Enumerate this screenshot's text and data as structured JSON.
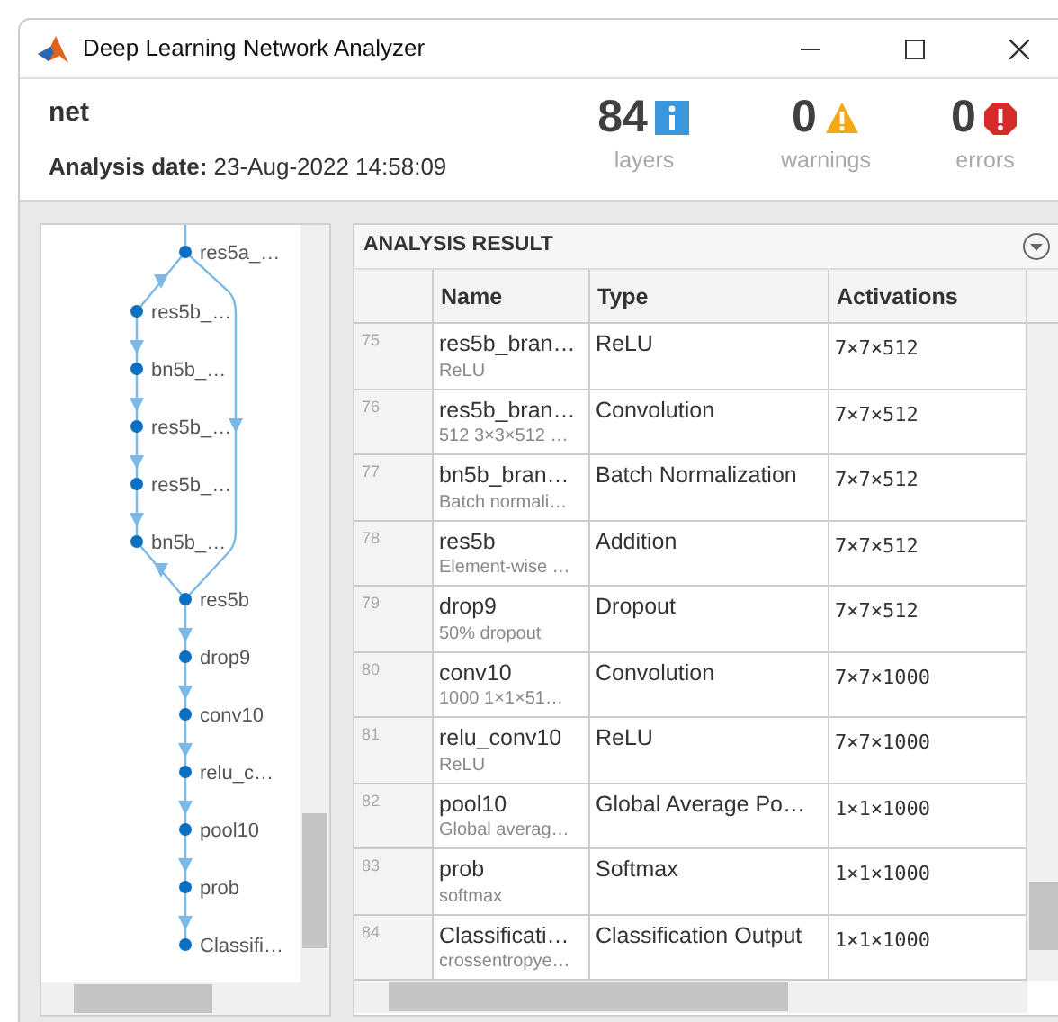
{
  "window": {
    "title": "Deep Learning Network Analyzer"
  },
  "header": {
    "network": "net",
    "analysis_date": "**Analysis date:** 23-Aug-2022 14:58:09"
  },
  "stats": [
    {
      "kind": "info",
      "value": "84",
      "label": "layers"
    },
    {
      "kind": "warning",
      "value": "0",
      "label": "warnings"
    },
    {
      "kind": "error",
      "value": "0",
      "label": "errors"
    }
  ],
  "graph": {
    "nodes": [
      {
        "label": "res5a_…",
        "kind": "main"
      },
      {
        "label": "res5b_…",
        "kind": "branch"
      },
      {
        "label": "bn5b_…",
        "kind": "branch"
      },
      {
        "label": "res5b_…",
        "kind": "branch"
      },
      {
        "label": "res5b_…",
        "kind": "branch"
      },
      {
        "label": "bn5b_…",
        "kind": "branch"
      },
      {
        "label": "res5b",
        "kind": "main"
      },
      {
        "label": "drop9",
        "kind": "main"
      },
      {
        "label": "conv10",
        "kind": "main"
      },
      {
        "label": "relu_c…",
        "kind": "main"
      },
      {
        "label": "pool10",
        "kind": "main"
      },
      {
        "label": "prob",
        "kind": "main"
      },
      {
        "label": "Classifi…",
        "kind": "main"
      }
    ]
  },
  "analysis_result": {
    "title": "ANALYSIS RESULT",
    "columns": [
      "Name",
      "Type",
      "Activations"
    ],
    "rows": [
      {
        "index": "75",
        "name": "res5b_bran…",
        "detail": "ReLU",
        "type": "ReLU",
        "activations": "7×7×512"
      },
      {
        "index": "76",
        "name": "res5b_bran…",
        "detail": "512 3×3×512 …",
        "type": "Convolution",
        "activations": "7×7×512"
      },
      {
        "index": "77",
        "name": "bn5b_bran…",
        "detail": "Batch normali…",
        "type": "Batch Normalization",
        "activations": "7×7×512"
      },
      {
        "index": "78",
        "name": "res5b",
        "detail": "Element-wise …",
        "type": "Addition",
        "activations": "7×7×512"
      },
      {
        "index": "79",
        "name": "drop9",
        "detail": "50% dropout",
        "type": "Dropout",
        "activations": "7×7×512"
      },
      {
        "index": "80",
        "name": "conv10",
        "detail": "1000 1×1×51…",
        "type": "Convolution",
        "activations": "7×7×1000"
      },
      {
        "index": "81",
        "name": "relu_conv10",
        "detail": "ReLU",
        "type": "ReLU",
        "activations": "7×7×1000"
      },
      {
        "index": "82",
        "name": "pool10",
        "detail": "Global averag…",
        "type": "Global Average Po…",
        "activations": "1×1×1000"
      },
      {
        "index": "83",
        "name": "prob",
        "detail": "softmax",
        "type": "Softmax",
        "activations": "1×1×1000"
      },
      {
        "index": "84",
        "name": "Classificati…",
        "detail": "crossentropye…",
        "type": "Classification Output",
        "activations": "1×1×1000"
      }
    ]
  }
}
